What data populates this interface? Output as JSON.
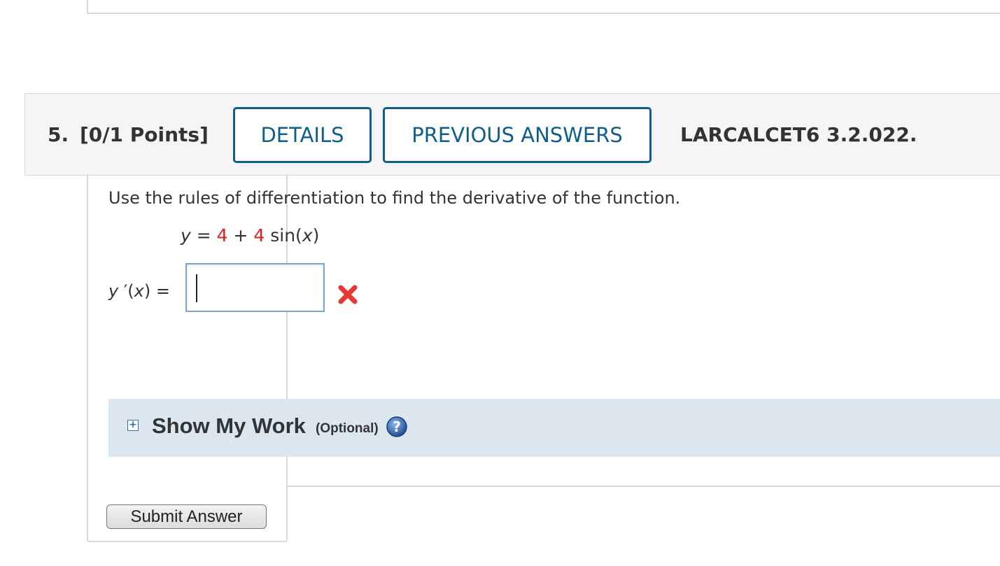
{
  "question": {
    "number": "5.",
    "points": "[0/1 Points]",
    "details_label": "DETAILS",
    "previous_answers_label": "PREVIOUS ANSWERS",
    "code": "LARCALCET6 3.2.022."
  },
  "problem": {
    "prompt": "Use the rules of differentiation to find the derivative of the function.",
    "eq_y": "y",
    "eq_equals": " = ",
    "eq_const1": "4",
    "eq_plus": " + ",
    "eq_const2": "4",
    "eq_sin": " sin(",
    "eq_x": "x",
    "eq_close": ")"
  },
  "answer": {
    "label_y": "y",
    "label_prime": " ′(",
    "label_x": "x",
    "label_rest": ") = ",
    "value": "",
    "status_icon": "wrong-x-icon",
    "status_color": "#e53935"
  },
  "show_my_work": {
    "title": "Show My Work",
    "optional": "(Optional)",
    "toggle_icon": "plus-box-icon",
    "help_icon": "question-circle-icon"
  },
  "submit_label": "Submit Answer",
  "colors": {
    "accent": "#0e5f8a",
    "highlight_value": "#e21b1b",
    "work_panel_bg": "#dce6ef"
  }
}
